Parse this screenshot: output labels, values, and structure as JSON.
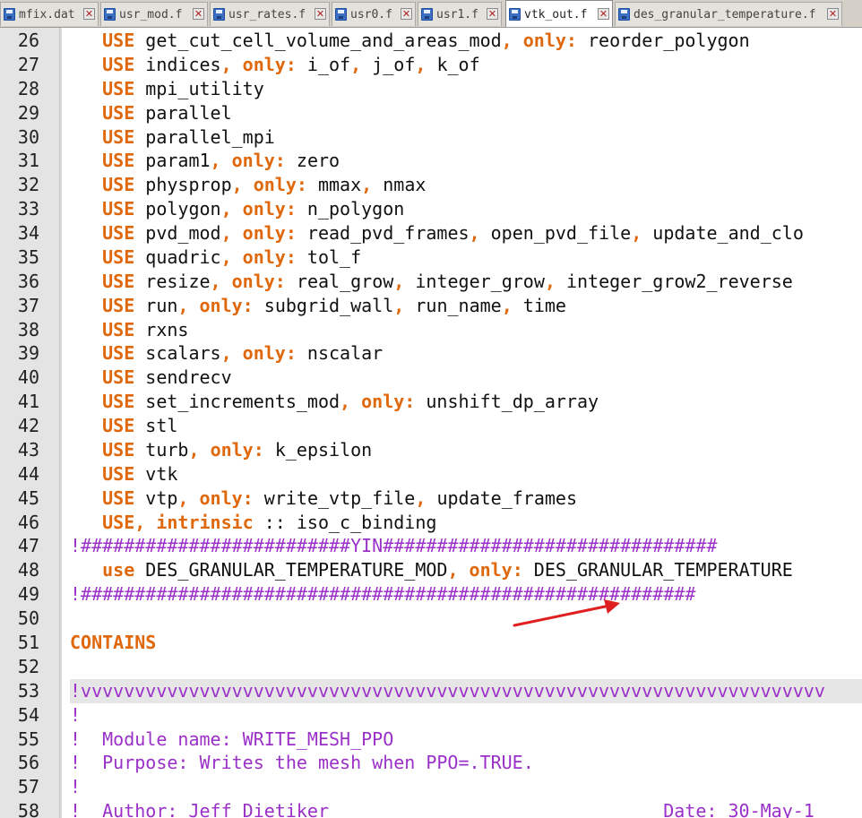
{
  "tabs": [
    {
      "label": "mfix.dat",
      "active": false
    },
    {
      "label": "usr_mod.f",
      "active": false
    },
    {
      "label": "usr_rates.f",
      "active": false
    },
    {
      "label": "usr0.f",
      "active": false
    },
    {
      "label": "usr1.f",
      "active": false
    },
    {
      "label": "vtk_out.f",
      "active": true
    },
    {
      "label": "des_granular_temperature.f",
      "active": false
    }
  ],
  "close_glyph": "✕",
  "colors": {
    "keyword": "#e0680c",
    "comment": "#9b30c8",
    "arrow": "#e02020",
    "gutter": "#e4e4e4",
    "current_line": "#e6e6e6"
  },
  "lines": [
    {
      "n": "26",
      "tokens": [
        [
          "   ",
          ""
        ],
        [
          "USE",
          "kw"
        ],
        [
          " get_cut_cell_volume_and_areas_mod",
          ""
        ],
        [
          ", ",
          "kw"
        ],
        [
          "only:",
          "kw"
        ],
        [
          " reorder_polygon",
          ""
        ]
      ]
    },
    {
      "n": "27",
      "tokens": [
        [
          "   ",
          ""
        ],
        [
          "USE",
          "kw"
        ],
        [
          " indices",
          ""
        ],
        [
          ", ",
          "kw"
        ],
        [
          "only:",
          "kw"
        ],
        [
          " i_of",
          ""
        ],
        [
          ", ",
          "kw"
        ],
        [
          "j_of",
          ""
        ],
        [
          ", ",
          "kw"
        ],
        [
          "k_of",
          ""
        ]
      ]
    },
    {
      "n": "28",
      "tokens": [
        [
          "   ",
          ""
        ],
        [
          "USE",
          "kw"
        ],
        [
          " mpi_utility",
          ""
        ]
      ]
    },
    {
      "n": "29",
      "tokens": [
        [
          "   ",
          ""
        ],
        [
          "USE",
          "kw"
        ],
        [
          " parallel",
          ""
        ]
      ]
    },
    {
      "n": "30",
      "tokens": [
        [
          "   ",
          ""
        ],
        [
          "USE",
          "kw"
        ],
        [
          " parallel_mpi",
          ""
        ]
      ]
    },
    {
      "n": "31",
      "tokens": [
        [
          "   ",
          ""
        ],
        [
          "USE",
          "kw"
        ],
        [
          " param1",
          ""
        ],
        [
          ", ",
          "kw"
        ],
        [
          "only:",
          "kw"
        ],
        [
          " zero",
          ""
        ]
      ]
    },
    {
      "n": "32",
      "tokens": [
        [
          "   ",
          ""
        ],
        [
          "USE",
          "kw"
        ],
        [
          " physprop",
          ""
        ],
        [
          ", ",
          "kw"
        ],
        [
          "only:",
          "kw"
        ],
        [
          " mmax",
          ""
        ],
        [
          ", ",
          "kw"
        ],
        [
          "nmax",
          ""
        ]
      ]
    },
    {
      "n": "33",
      "tokens": [
        [
          "   ",
          ""
        ],
        [
          "USE",
          "kw"
        ],
        [
          " polygon",
          ""
        ],
        [
          ", ",
          "kw"
        ],
        [
          "only:",
          "kw"
        ],
        [
          " n_polygon",
          ""
        ]
      ]
    },
    {
      "n": "34",
      "tokens": [
        [
          "   ",
          ""
        ],
        [
          "USE",
          "kw"
        ],
        [
          " pvd_mod",
          ""
        ],
        [
          ", ",
          "kw"
        ],
        [
          "only:",
          "kw"
        ],
        [
          " read_pvd_frames",
          ""
        ],
        [
          ", ",
          "kw"
        ],
        [
          "open_pvd_file",
          ""
        ],
        [
          ", ",
          "kw"
        ],
        [
          "update_and_clo",
          ""
        ]
      ]
    },
    {
      "n": "35",
      "tokens": [
        [
          "   ",
          ""
        ],
        [
          "USE",
          "kw"
        ],
        [
          " quadric",
          ""
        ],
        [
          ", ",
          "kw"
        ],
        [
          "only:",
          "kw"
        ],
        [
          " tol_f",
          ""
        ]
      ]
    },
    {
      "n": "36",
      "tokens": [
        [
          "   ",
          ""
        ],
        [
          "USE",
          "kw"
        ],
        [
          " resize",
          ""
        ],
        [
          ", ",
          "kw"
        ],
        [
          "only:",
          "kw"
        ],
        [
          " real_grow",
          ""
        ],
        [
          ", ",
          "kw"
        ],
        [
          "integer_grow",
          ""
        ],
        [
          ", ",
          "kw"
        ],
        [
          "integer_grow2_reverse",
          ""
        ]
      ]
    },
    {
      "n": "37",
      "tokens": [
        [
          "   ",
          ""
        ],
        [
          "USE",
          "kw"
        ],
        [
          " run",
          ""
        ],
        [
          ", ",
          "kw"
        ],
        [
          "only:",
          "kw"
        ],
        [
          " subgrid_wall",
          ""
        ],
        [
          ", ",
          "kw"
        ],
        [
          "run_name",
          ""
        ],
        [
          ", ",
          "kw"
        ],
        [
          "time",
          ""
        ]
      ]
    },
    {
      "n": "38",
      "tokens": [
        [
          "   ",
          ""
        ],
        [
          "USE",
          "kw"
        ],
        [
          " rxns",
          ""
        ]
      ]
    },
    {
      "n": "39",
      "tokens": [
        [
          "   ",
          ""
        ],
        [
          "USE",
          "kw"
        ],
        [
          " scalars",
          ""
        ],
        [
          ", ",
          "kw"
        ],
        [
          "only:",
          "kw"
        ],
        [
          " nscalar",
          ""
        ]
      ]
    },
    {
      "n": "40",
      "tokens": [
        [
          "   ",
          ""
        ],
        [
          "USE",
          "kw"
        ],
        [
          " sendrecv",
          ""
        ]
      ]
    },
    {
      "n": "41",
      "tokens": [
        [
          "   ",
          ""
        ],
        [
          "USE",
          "kw"
        ],
        [
          " set_increments_mod",
          ""
        ],
        [
          ", ",
          "kw"
        ],
        [
          "only:",
          "kw"
        ],
        [
          " unshift_dp_array",
          ""
        ]
      ]
    },
    {
      "n": "42",
      "tokens": [
        [
          "   ",
          ""
        ],
        [
          "USE",
          "kw"
        ],
        [
          " stl",
          ""
        ]
      ]
    },
    {
      "n": "43",
      "tokens": [
        [
          "   ",
          ""
        ],
        [
          "USE",
          "kw"
        ],
        [
          " turb",
          ""
        ],
        [
          ", ",
          "kw"
        ],
        [
          "only:",
          "kw"
        ],
        [
          " k_epsilon",
          ""
        ]
      ]
    },
    {
      "n": "44",
      "tokens": [
        [
          "   ",
          ""
        ],
        [
          "USE",
          "kw"
        ],
        [
          " vtk",
          ""
        ]
      ]
    },
    {
      "n": "45",
      "tokens": [
        [
          "   ",
          ""
        ],
        [
          "USE",
          "kw"
        ],
        [
          " vtp",
          ""
        ],
        [
          ", ",
          "kw"
        ],
        [
          "only:",
          "kw"
        ],
        [
          " write_vtp_file",
          ""
        ],
        [
          ", ",
          "kw"
        ],
        [
          "update_frames",
          ""
        ]
      ]
    },
    {
      "n": "46",
      "tokens": [
        [
          "   ",
          ""
        ],
        [
          "USE",
          "kw"
        ],
        [
          ", ",
          "kw"
        ],
        [
          "intrinsic",
          "kw"
        ],
        [
          " :: iso_c_binding",
          ""
        ]
      ]
    },
    {
      "n": "47",
      "tokens": [
        [
          "!#########################YIN###############################",
          "cm"
        ]
      ]
    },
    {
      "n": "48",
      "tokens": [
        [
          "   ",
          ""
        ],
        [
          "use",
          "kw"
        ],
        [
          " DES_GRANULAR_TEMPERATURE_MOD",
          ""
        ],
        [
          ", ",
          "kw"
        ],
        [
          "only:",
          "kw"
        ],
        [
          " DES_GRANULAR_TEMPERATURE",
          ""
        ]
      ]
    },
    {
      "n": "49",
      "tokens": [
        [
          "!#########################################################",
          "cm"
        ]
      ]
    },
    {
      "n": "50",
      "tokens": []
    },
    {
      "n": "51",
      "tokens": [
        [
          "CONTAINS",
          "kw"
        ]
      ]
    },
    {
      "n": "52",
      "tokens": []
    },
    {
      "n": "53",
      "highlight": true,
      "tokens": [
        [
          "!vvvvvvvvvvvvvvvvvvvvvvvvvvvvvvvvvvvvvvvvvvvvvvvvvvvvvvvvvvvvvvvvvvvvv",
          "cm"
        ]
      ]
    },
    {
      "n": "54",
      "tokens": [
        [
          "!",
          "cm"
        ]
      ]
    },
    {
      "n": "55",
      "tokens": [
        [
          "!  Module name: WRITE_MESH_PPO",
          "cm"
        ]
      ]
    },
    {
      "n": "56",
      "tokens": [
        [
          "!  Purpose: Writes the mesh when PPO=.TRUE.",
          "cm"
        ]
      ]
    },
    {
      "n": "57",
      "tokens": [
        [
          "!",
          "cm"
        ]
      ]
    },
    {
      "n": "58",
      "tokens": [
        [
          "!  Author: Jeff Dietiker                               Date: 30-May-1",
          "cm"
        ]
      ]
    }
  ]
}
